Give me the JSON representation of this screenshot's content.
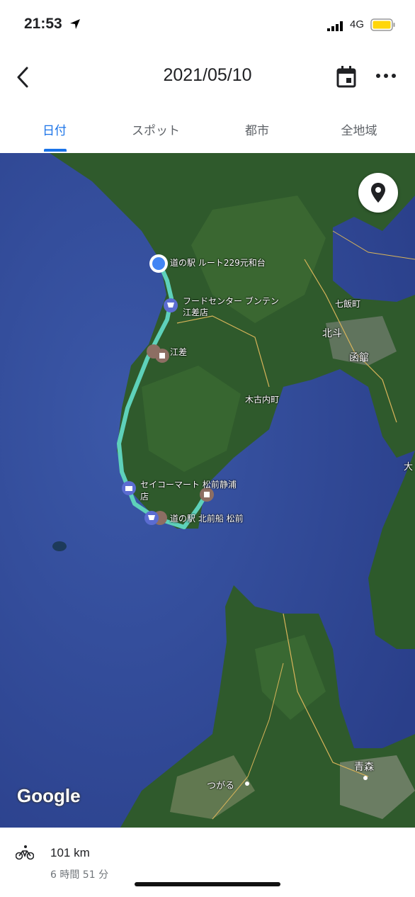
{
  "status": {
    "time": "21:53",
    "network": "4G",
    "battery_color": "#FFD60A"
  },
  "header": {
    "title": "2021/05/10"
  },
  "tabs": [
    {
      "label": "日付",
      "active": true
    },
    {
      "label": "スポット",
      "active": false
    },
    {
      "label": "都市",
      "active": false
    },
    {
      "label": "全地域",
      "active": false
    }
  ],
  "map": {
    "attribution": "Google",
    "route_color": "#5ED1BA",
    "labels": {
      "start": "道の駅 ルート229元和台",
      "foodcenter": "フードセンター ブンテン",
      "foodcenter2": "江差店",
      "nanae": "七飯町",
      "hokuto": "北斗",
      "hakodate": "函館",
      "esashi": "江差",
      "kikonai": "木古内町",
      "seicomart": "セイコーマート 松前静浦",
      "seicomart2": "店",
      "matsumae_station": "道の駅 北前船 松前",
      "aomori": "青森",
      "tsugaru": "つがる",
      "edge": "大"
    }
  },
  "summary": {
    "distance": "101 km",
    "duration": "6 時間 51 分"
  }
}
